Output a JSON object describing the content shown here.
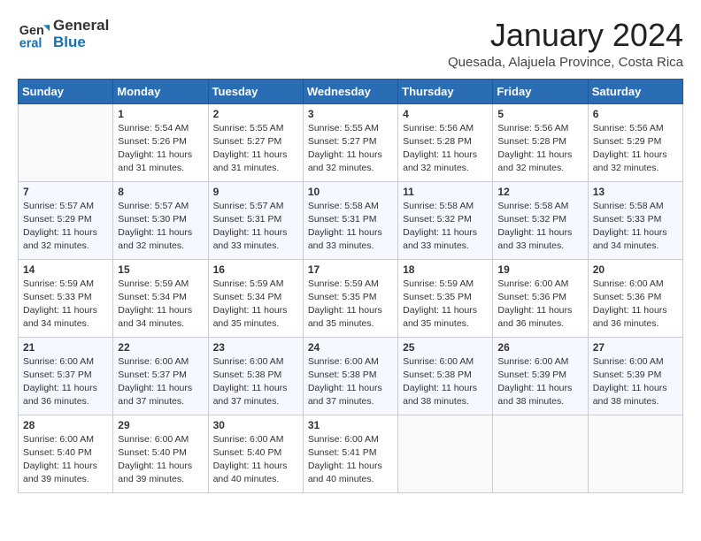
{
  "logo": {
    "line1": "General",
    "line2": "Blue"
  },
  "title": "January 2024",
  "subtitle": "Quesada, Alajuela Province, Costa Rica",
  "days_header": [
    "Sunday",
    "Monday",
    "Tuesday",
    "Wednesday",
    "Thursday",
    "Friday",
    "Saturday"
  ],
  "weeks": [
    [
      {
        "day": "",
        "empty": true
      },
      {
        "day": "1",
        "sunrise": "5:54 AM",
        "sunset": "5:26 PM",
        "daylight": "11 hours and 31 minutes."
      },
      {
        "day": "2",
        "sunrise": "5:55 AM",
        "sunset": "5:27 PM",
        "daylight": "11 hours and 31 minutes."
      },
      {
        "day": "3",
        "sunrise": "5:55 AM",
        "sunset": "5:27 PM",
        "daylight": "11 hours and 32 minutes."
      },
      {
        "day": "4",
        "sunrise": "5:56 AM",
        "sunset": "5:28 PM",
        "daylight": "11 hours and 32 minutes."
      },
      {
        "day": "5",
        "sunrise": "5:56 AM",
        "sunset": "5:28 PM",
        "daylight": "11 hours and 32 minutes."
      },
      {
        "day": "6",
        "sunrise": "5:56 AM",
        "sunset": "5:29 PM",
        "daylight": "11 hours and 32 minutes."
      }
    ],
    [
      {
        "day": "7",
        "sunrise": "5:57 AM",
        "sunset": "5:29 PM",
        "daylight": "11 hours and 32 minutes."
      },
      {
        "day": "8",
        "sunrise": "5:57 AM",
        "sunset": "5:30 PM",
        "daylight": "11 hours and 32 minutes."
      },
      {
        "day": "9",
        "sunrise": "5:57 AM",
        "sunset": "5:31 PM",
        "daylight": "11 hours and 33 minutes."
      },
      {
        "day": "10",
        "sunrise": "5:58 AM",
        "sunset": "5:31 PM",
        "daylight": "11 hours and 33 minutes."
      },
      {
        "day": "11",
        "sunrise": "5:58 AM",
        "sunset": "5:32 PM",
        "daylight": "11 hours and 33 minutes."
      },
      {
        "day": "12",
        "sunrise": "5:58 AM",
        "sunset": "5:32 PM",
        "daylight": "11 hours and 33 minutes."
      },
      {
        "day": "13",
        "sunrise": "5:58 AM",
        "sunset": "5:33 PM",
        "daylight": "11 hours and 34 minutes."
      }
    ],
    [
      {
        "day": "14",
        "sunrise": "5:59 AM",
        "sunset": "5:33 PM",
        "daylight": "11 hours and 34 minutes."
      },
      {
        "day": "15",
        "sunrise": "5:59 AM",
        "sunset": "5:34 PM",
        "daylight": "11 hours and 34 minutes."
      },
      {
        "day": "16",
        "sunrise": "5:59 AM",
        "sunset": "5:34 PM",
        "daylight": "11 hours and 35 minutes."
      },
      {
        "day": "17",
        "sunrise": "5:59 AM",
        "sunset": "5:35 PM",
        "daylight": "11 hours and 35 minutes."
      },
      {
        "day": "18",
        "sunrise": "5:59 AM",
        "sunset": "5:35 PM",
        "daylight": "11 hours and 35 minutes."
      },
      {
        "day": "19",
        "sunrise": "6:00 AM",
        "sunset": "5:36 PM",
        "daylight": "11 hours and 36 minutes."
      },
      {
        "day": "20",
        "sunrise": "6:00 AM",
        "sunset": "5:36 PM",
        "daylight": "11 hours and 36 minutes."
      }
    ],
    [
      {
        "day": "21",
        "sunrise": "6:00 AM",
        "sunset": "5:37 PM",
        "daylight": "11 hours and 36 minutes."
      },
      {
        "day": "22",
        "sunrise": "6:00 AM",
        "sunset": "5:37 PM",
        "daylight": "11 hours and 37 minutes."
      },
      {
        "day": "23",
        "sunrise": "6:00 AM",
        "sunset": "5:38 PM",
        "daylight": "11 hours and 37 minutes."
      },
      {
        "day": "24",
        "sunrise": "6:00 AM",
        "sunset": "5:38 PM",
        "daylight": "11 hours and 37 minutes."
      },
      {
        "day": "25",
        "sunrise": "6:00 AM",
        "sunset": "5:38 PM",
        "daylight": "11 hours and 38 minutes."
      },
      {
        "day": "26",
        "sunrise": "6:00 AM",
        "sunset": "5:39 PM",
        "daylight": "11 hours and 38 minutes."
      },
      {
        "day": "27",
        "sunrise": "6:00 AM",
        "sunset": "5:39 PM",
        "daylight": "11 hours and 38 minutes."
      }
    ],
    [
      {
        "day": "28",
        "sunrise": "6:00 AM",
        "sunset": "5:40 PM",
        "daylight": "11 hours and 39 minutes."
      },
      {
        "day": "29",
        "sunrise": "6:00 AM",
        "sunset": "5:40 PM",
        "daylight": "11 hours and 39 minutes."
      },
      {
        "day": "30",
        "sunrise": "6:00 AM",
        "sunset": "5:40 PM",
        "daylight": "11 hours and 40 minutes."
      },
      {
        "day": "31",
        "sunrise": "6:00 AM",
        "sunset": "5:41 PM",
        "daylight": "11 hours and 40 minutes."
      },
      {
        "day": "",
        "empty": true
      },
      {
        "day": "",
        "empty": true
      },
      {
        "day": "",
        "empty": true
      }
    ]
  ]
}
